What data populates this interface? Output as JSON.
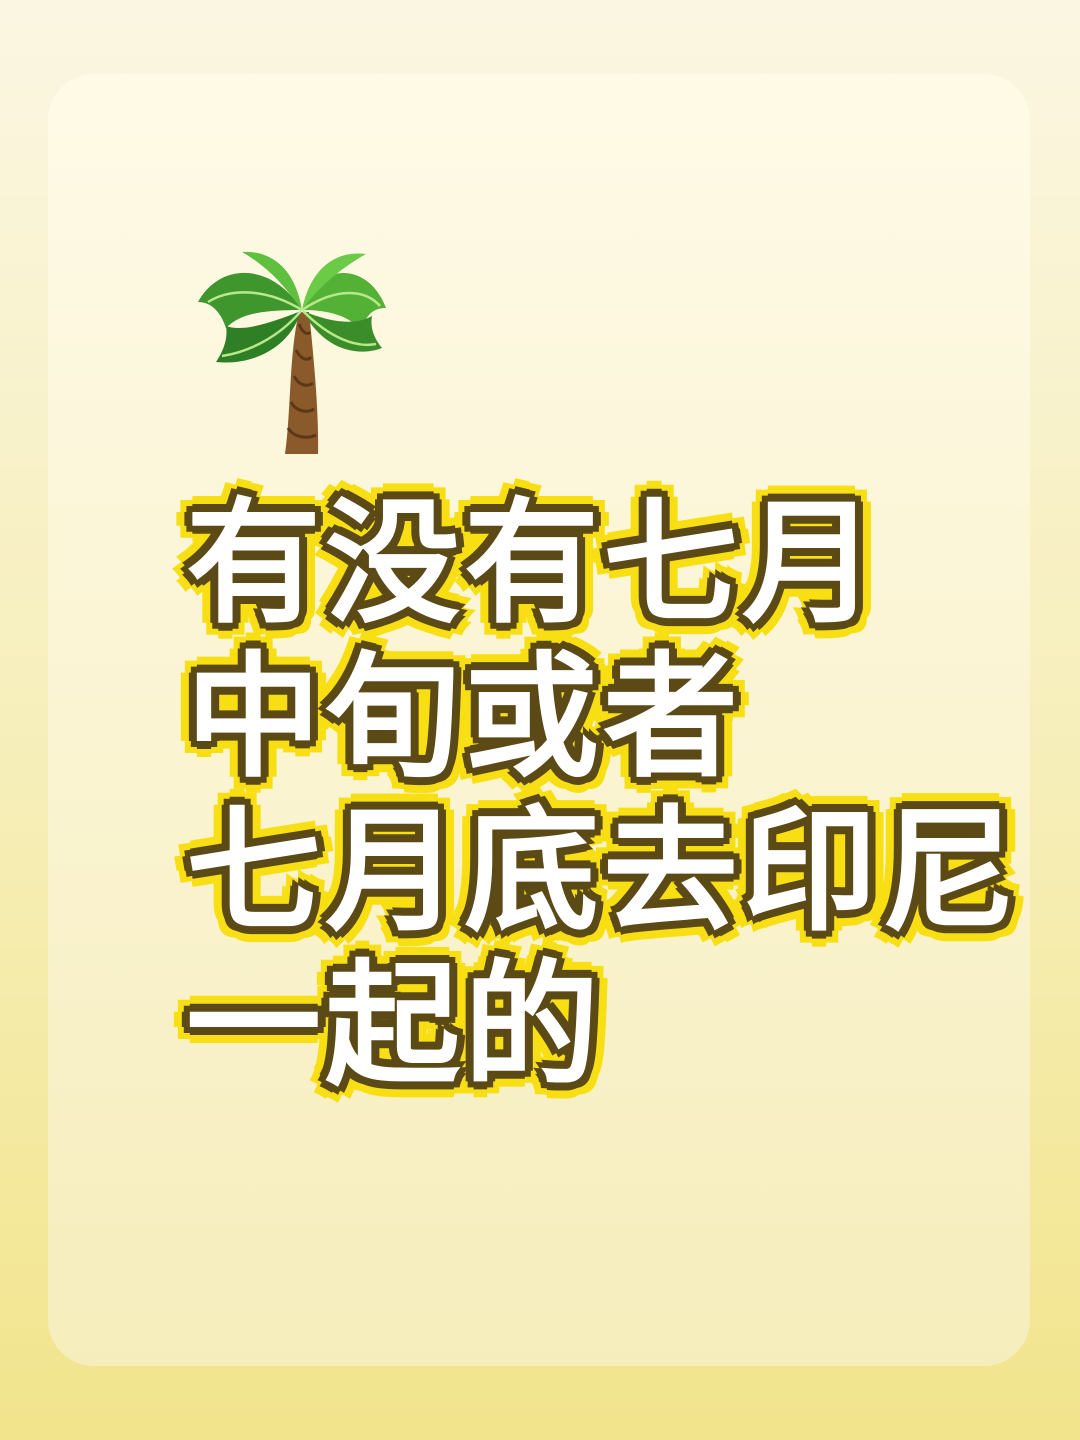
{
  "background": {
    "top_color": "#fbf6e2",
    "bottom_color": "#f2e48c",
    "card_color": "#fdf8e6"
  },
  "decoration": {
    "icon": "palm-tree-icon",
    "leaf_color": "#4aa92a",
    "trunk_color": "#8a5a2b"
  },
  "headline": {
    "lines": [
      "有没有七月",
      "中旬或者",
      "七月底去印尼",
      "一起的"
    ],
    "fill_color": "#ffffff",
    "inner_outline_color": "#5b4a16",
    "outer_outline_color": "#f8df14"
  }
}
